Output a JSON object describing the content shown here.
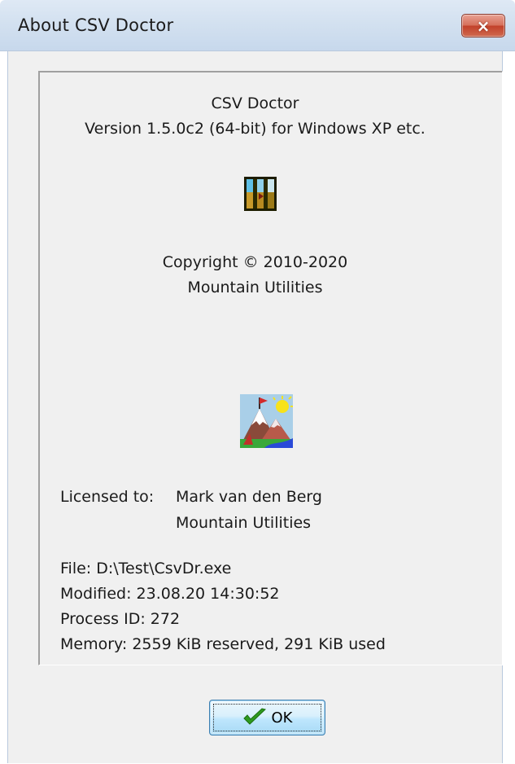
{
  "window": {
    "title": "About CSV Doctor",
    "close_glyph": "×"
  },
  "about": {
    "product": "CSV Doctor",
    "version": "Version 1.5.0c2 (64-bit) for Windows XP etc.",
    "copyright": "Copyright © 2010-2020",
    "company": "Mountain Utilities",
    "app_icon": "csv-doctor-app-icon",
    "logo_icon": "mountain-utilities-logo-icon"
  },
  "license": {
    "label": "Licensed to:",
    "name": "Mark van den Berg",
    "organization": "Mountain Utilities"
  },
  "file_info": {
    "file": "File: D:\\Test\\CsvDr.exe",
    "modified": "Modified: 23.08.20 14:30:52",
    "process_id": "Process ID: 272",
    "memory": "Memory: 2559 KiB reserved, 291 KiB used"
  },
  "buttons": {
    "ok_label": "OK",
    "ok_icon": "checkmark-icon"
  },
  "colors": {
    "titlebar": "#d3e1f0",
    "client_bg": "#f0f0f0",
    "close_button": "#c94a33",
    "ok_button": "#bee6fd",
    "checkmark": "#2e9a1e"
  }
}
